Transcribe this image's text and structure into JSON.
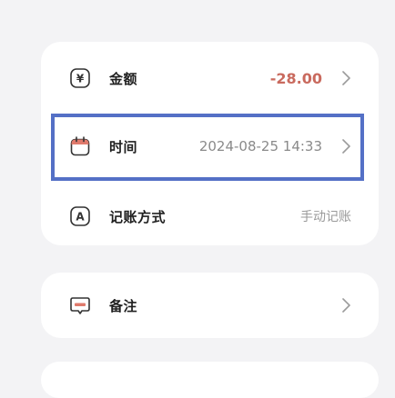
{
  "entry": {
    "amount": {
      "icon": "yen-icon",
      "icon_text": "¥",
      "label": "金额",
      "value": "-28.00"
    },
    "time": {
      "icon": "calendar-icon",
      "label": "时间",
      "value": "2024-08-25 14:33"
    },
    "method": {
      "icon": "letter-a-icon",
      "icon_text": "A",
      "label": "记账方式",
      "value": "手动记账"
    }
  },
  "note": {
    "icon": "note-icon",
    "label": "备注"
  },
  "colors": {
    "background": "#f3f3f5",
    "card": "#ffffff",
    "amount_negative": "#c96a5e",
    "calendar_accent": "#e07a6c",
    "highlight_box": "#5470c6"
  }
}
